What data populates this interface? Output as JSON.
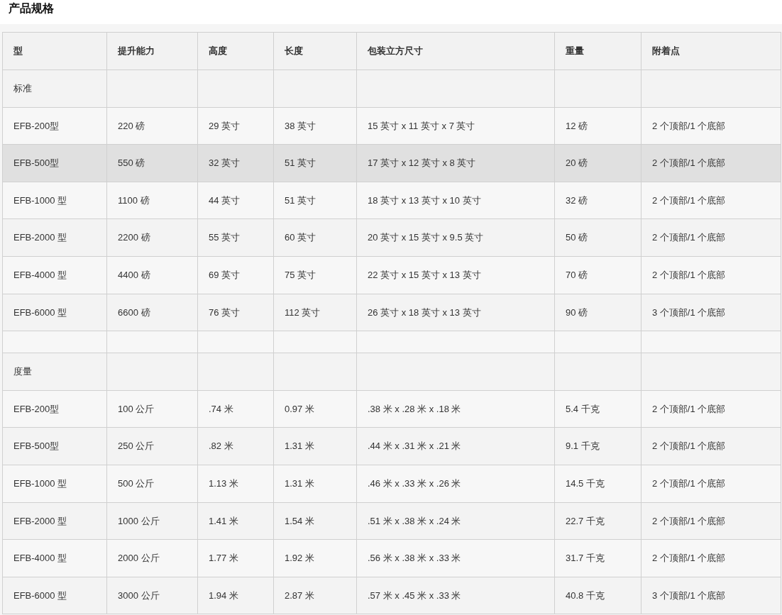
{
  "title": "产品规格",
  "table": {
    "columns": [
      "型",
      "提升能力",
      "高度",
      "长度",
      "包装立方尺寸",
      "重量",
      "附着点"
    ],
    "rows": [
      {
        "kind": "section",
        "label": "标准"
      },
      {
        "kind": "data",
        "highlighted": false,
        "cells": [
          "EFB-200型",
          "220 磅",
          "29 英寸",
          "38 英寸",
          "15 英寸 x 11 英寸 x 7 英寸",
          "12 磅",
          "2 个顶部/1 个底部"
        ]
      },
      {
        "kind": "data",
        "highlighted": true,
        "cells": [
          "EFB-500型",
          "550 磅",
          "32 英寸",
          "51 英寸",
          "17 英寸 x 12 英寸 x 8 英寸",
          "20 磅",
          "2 个顶部/1 个底部"
        ]
      },
      {
        "kind": "data",
        "highlighted": false,
        "cells": [
          "EFB-1000 型",
          "1100 磅",
          "44 英寸",
          "51 英寸",
          "18 英寸 x 13 英寸 x 10 英寸",
          "32 磅",
          "2 个顶部/1 个底部"
        ]
      },
      {
        "kind": "data",
        "highlighted": false,
        "cells": [
          "EFB-2000 型",
          "2200 磅",
          "55 英寸",
          "60 英寸",
          "20 英寸 x 15 英寸 x 9.5 英寸",
          "50 磅",
          "2 个顶部/1 个底部"
        ]
      },
      {
        "kind": "data",
        "highlighted": false,
        "cells": [
          "EFB-4000 型",
          "4400 磅",
          "69 英寸",
          "75 英寸",
          "22 英寸 x 15 英寸 x 13 英寸",
          "70 磅",
          "2 个顶部/1 个底部"
        ]
      },
      {
        "kind": "data",
        "highlighted": false,
        "cells": [
          "EFB-6000 型",
          "6600 磅",
          "76 英寸",
          "112 英寸",
          "26 英寸 x 18 英寸 x 13 英寸",
          "90 磅",
          "3 个顶部/1 个底部"
        ]
      },
      {
        "kind": "spacer"
      },
      {
        "kind": "section",
        "label": "度量"
      },
      {
        "kind": "data",
        "highlighted": false,
        "cells": [
          "EFB-200型",
          "100 公斤",
          ".74 米",
          "0.97 米",
          ".38 米 x .28 米 x .18 米",
          "5.4 千克",
          "2 个顶部/1 个底部"
        ]
      },
      {
        "kind": "data",
        "highlighted": false,
        "cells": [
          "EFB-500型",
          "250 公斤",
          ".82 米",
          "1.31 米",
          ".44 米 x .31 米 x .21 米",
          "9.1 千克",
          "2 个顶部/1 个底部"
        ]
      },
      {
        "kind": "data",
        "highlighted": false,
        "cells": [
          "EFB-1000 型",
          "500 公斤",
          "1.13 米",
          "1.31 米",
          ".46 米 x .33 米 x .26 米",
          "14.5 千克",
          "2 个顶部/1 个底部"
        ]
      },
      {
        "kind": "data",
        "highlighted": false,
        "cells": [
          "EFB-2000 型",
          "1000 公斤",
          "1.41 米",
          "1.54 米",
          ".51 米 x .38 米 x .24 米",
          "22.7 千克",
          "2 个顶部/1 个底部"
        ]
      },
      {
        "kind": "data",
        "highlighted": false,
        "cells": [
          "EFB-4000 型",
          "2000 公斤",
          "1.77 米",
          "1.92 米",
          ".56 米 x .38 米 x .33 米",
          "31.7 千克",
          "2 个顶部/1 个底部"
        ]
      },
      {
        "kind": "data",
        "highlighted": false,
        "cells": [
          "EFB-6000 型",
          "3000 公斤",
          "1.94 米",
          "2.87 米",
          ".57 米 x .45 米 x .33 米",
          "40.8 千克",
          "3 个顶部/1 个底部"
        ]
      }
    ]
  }
}
